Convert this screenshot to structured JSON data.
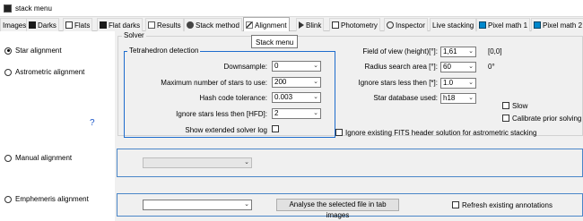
{
  "window": {
    "title": "stack menu"
  },
  "tabs": [
    {
      "label": "Images",
      "icon": ""
    },
    {
      "label": "Darks",
      "icon": "square-dark-icon"
    },
    {
      "label": "Flats",
      "icon": "square-white-icon"
    },
    {
      "label": "Flat darks",
      "icon": "square-dark-icon"
    },
    {
      "label": "Results",
      "icon": "document-icon"
    },
    {
      "label": "Stack method",
      "icon": "gear-icon"
    },
    {
      "label": "Alignment",
      "icon": "stars-icon"
    },
    {
      "label": "Blink",
      "icon": "play-icon"
    },
    {
      "label": "Photometry",
      "icon": "photometry-icon"
    },
    {
      "label": "Inspector",
      "icon": "magnifier-icon"
    },
    {
      "label": "Live stacking",
      "icon": ""
    },
    {
      "label": "Pixel math 1",
      "icon": "graph-icon"
    },
    {
      "label": "Pixel math 2",
      "icon": "graph-icon"
    }
  ],
  "tooltip": "Stack menu",
  "alignment_methods": [
    {
      "label": "Star alignment",
      "selected": true
    },
    {
      "label": "Astrometric alignment",
      "selected": false
    },
    {
      "label": "Manual alignment",
      "selected": false
    },
    {
      "label": "Emphemeris alignment",
      "selected": false
    }
  ],
  "help_icon": "?",
  "solver": {
    "group_label": "Solver",
    "tetra_label": "Tetrahedron detection",
    "downsample": {
      "label": "Downsample:",
      "value": "0"
    },
    "max_stars": {
      "label": "Maximum number of stars to use:",
      "value": "200"
    },
    "hash_tolerance": {
      "label": "Hash code tolerance:",
      "value": "0.003"
    },
    "ignore_hfd": {
      "label": "Ignore stars less then [HFD]:",
      "value": "2"
    },
    "extended_log": {
      "label": "Show extended solver log",
      "checked": false
    },
    "fov": {
      "label": "Field of view (height)[°]:",
      "value": "1,61",
      "note": "[0,0]"
    },
    "radius": {
      "label": "Radius search area [°]:",
      "value": "60",
      "note": "0°"
    },
    "ignore_mag": {
      "label": "Ignore stars less then [*]:",
      "value": "1.0"
    },
    "database": {
      "label": "Star database used:",
      "value": "h18"
    },
    "slow": {
      "label": "Slow",
      "checked": false
    },
    "calibrate": {
      "label": "Calibrate prior solving",
      "checked": false
    },
    "ignore_fits": {
      "label": "Ignore existing FITS header solution for astrometric stacking",
      "checked": false
    }
  },
  "manual": {
    "dropdown": ""
  },
  "ephemeris": {
    "dropdown": "",
    "analyse_button": "Analyse the selected file in tab images",
    "refresh": {
      "label": "Refresh existing annotations",
      "checked": false
    }
  }
}
